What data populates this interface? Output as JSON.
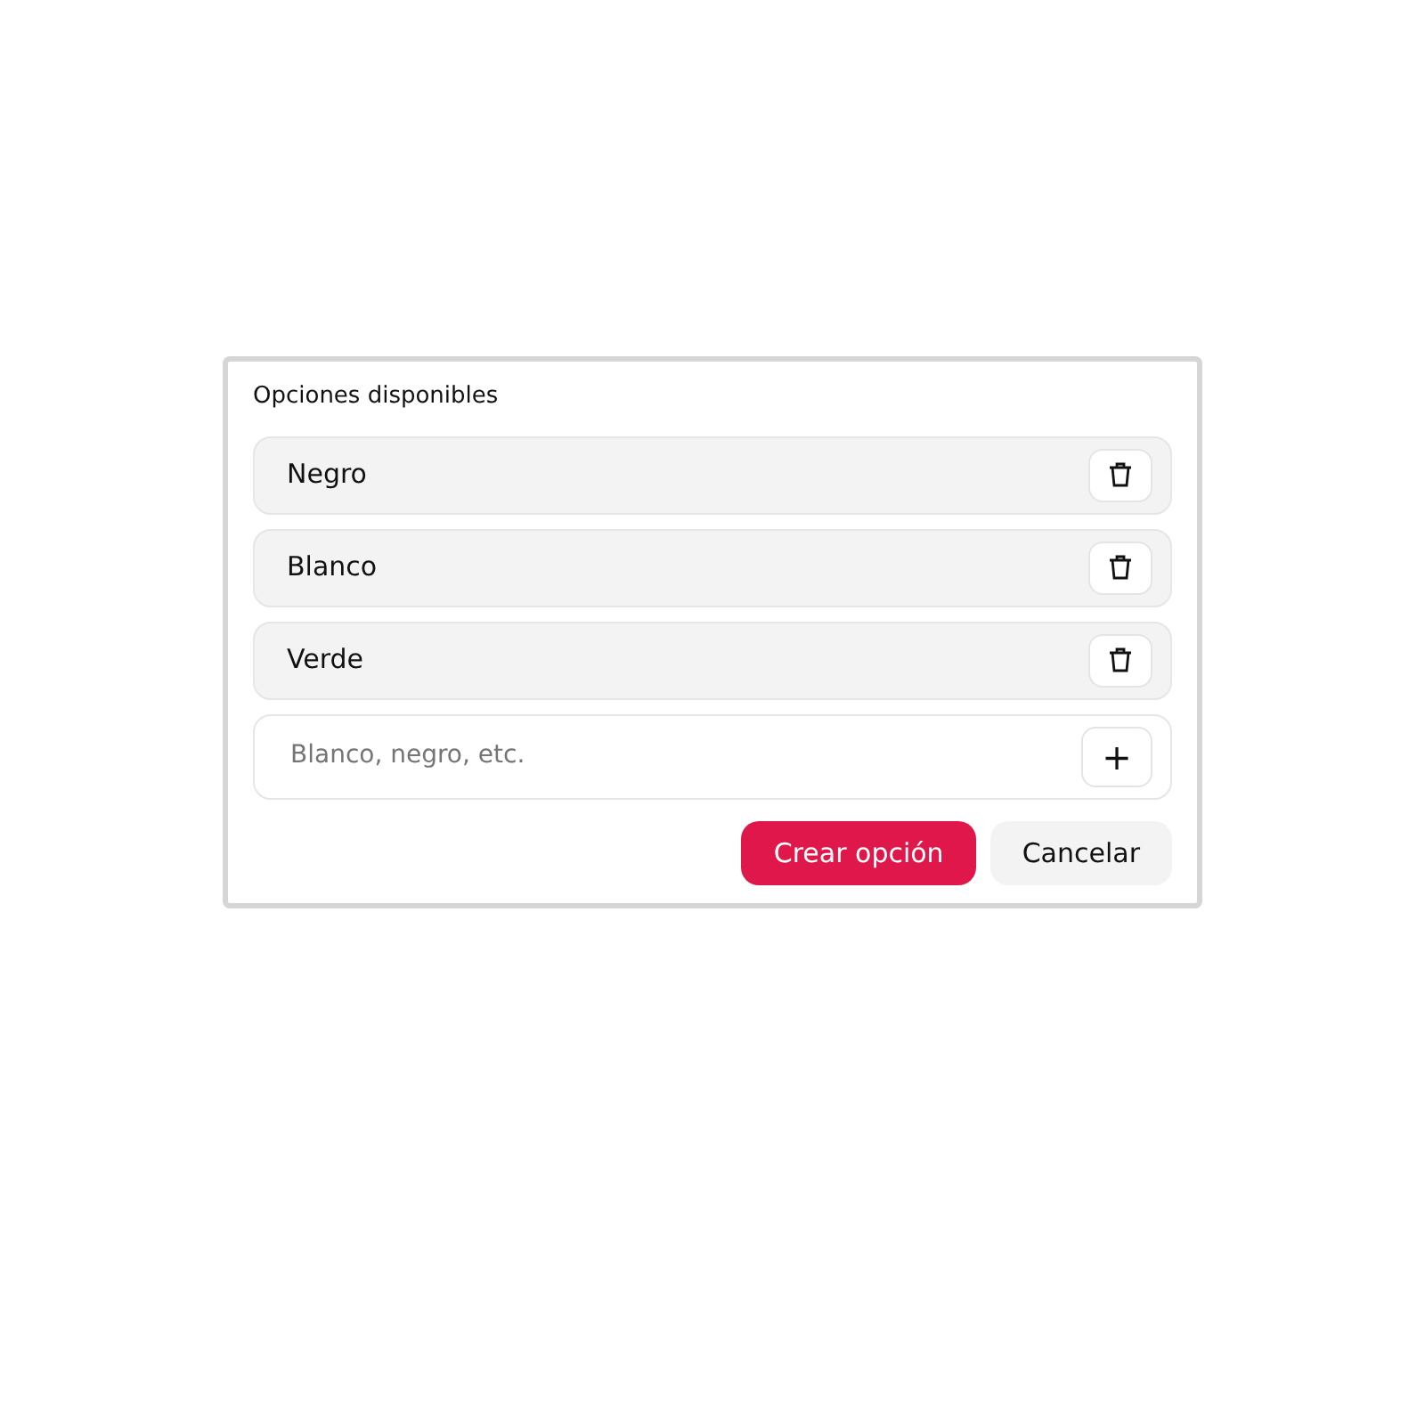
{
  "panel": {
    "title": "Opciones disponibles"
  },
  "options": [
    {
      "label": "Negro"
    },
    {
      "label": "Blanco"
    },
    {
      "label": "Verde"
    }
  ],
  "new_option": {
    "placeholder": "Blanco, negro, etc.",
    "add_button": "+"
  },
  "buttons": [
    {
      "label": "Crear opción",
      "kind": "primary"
    },
    {
      "label": "Cancelar",
      "kind": "secondary"
    }
  ]
}
